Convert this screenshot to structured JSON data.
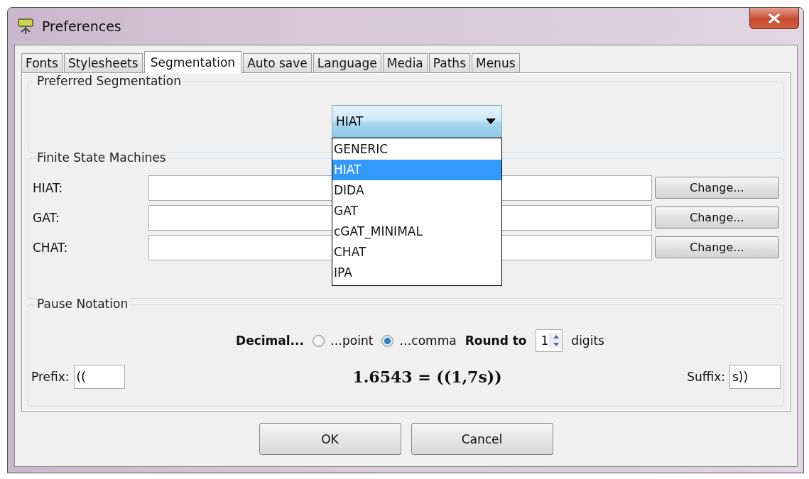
{
  "window": {
    "title": "Preferences"
  },
  "tabs": [
    {
      "label": "Fonts",
      "selected": false
    },
    {
      "label": "Stylesheets",
      "selected": false
    },
    {
      "label": "Segmentation",
      "selected": true
    },
    {
      "label": "Auto save",
      "selected": false
    },
    {
      "label": "Language",
      "selected": false
    },
    {
      "label": "Media",
      "selected": false
    },
    {
      "label": "Paths",
      "selected": false
    },
    {
      "label": "Menus",
      "selected": false
    }
  ],
  "preferred_segmentation": {
    "title": "Preferred Segmentation",
    "dropdown": {
      "value": "HIAT",
      "expanded": true,
      "options": [
        {
          "label": "GENERIC",
          "selected": false
        },
        {
          "label": "HIAT",
          "selected": true
        },
        {
          "label": "DIDA",
          "selected": false
        },
        {
          "label": "GAT",
          "selected": false
        },
        {
          "label": "cGAT_MINIMAL",
          "selected": false
        },
        {
          "label": "CHAT",
          "selected": false
        },
        {
          "label": "IPA",
          "selected": false
        }
      ]
    }
  },
  "finite_state_machines": {
    "title": "Finite State Machines",
    "rows": [
      {
        "label": "HIAT:",
        "button": "Change..."
      },
      {
        "label": "GAT:",
        "button": "Change..."
      },
      {
        "label": "CHAT:",
        "button": "Change..."
      }
    ]
  },
  "pause_notation": {
    "title": "Pause Notation",
    "decimal_label": "Decimal...",
    "options": [
      {
        "label": "…point",
        "selected": false
      },
      {
        "label": "…comma",
        "selected": true
      }
    ],
    "round_label": "Round to",
    "round_value": "1",
    "digits_label": "digits",
    "prefix_label": "Prefix:",
    "prefix_value": "((",
    "example": "1.6543 = ((1,7s))",
    "suffix_label": "Suffix:",
    "suffix_value": "s))"
  },
  "buttons": [
    "OK",
    "Cancel"
  ]
}
